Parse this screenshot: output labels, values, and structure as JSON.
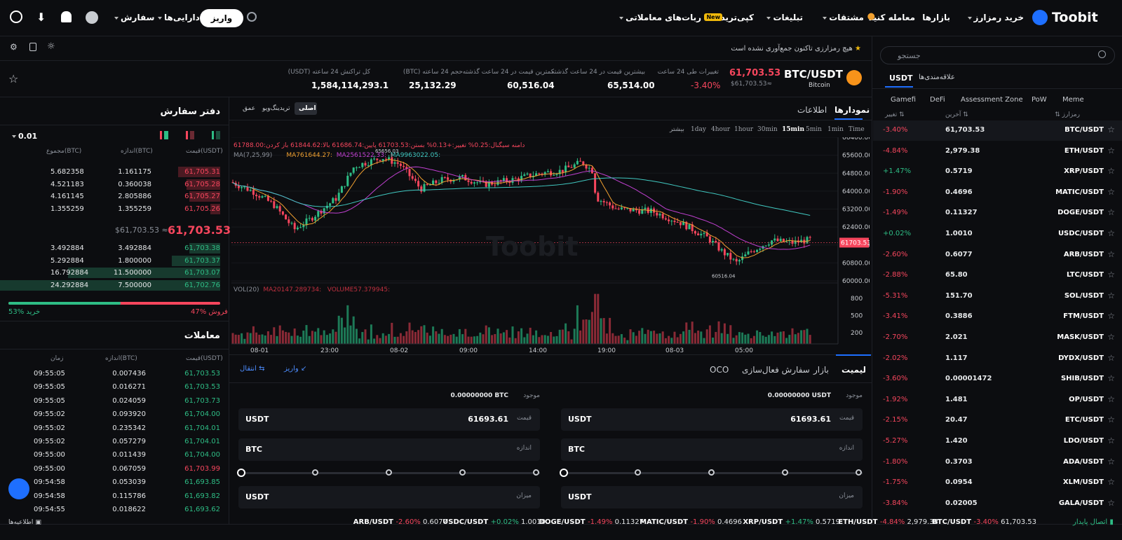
{
  "topbar": {
    "brand": "Toobit",
    "buy_crypto": "خرید رمزارز",
    "markets": "بازارها",
    "trade": "معامله کنید",
    "derivatives": "مشتقات",
    "promotions": "تبلیغات",
    "copy_trade": "کپی‌ترید",
    "bots": "ربات‌های معاملاتی",
    "new_badge": "New",
    "deposit": "واریز",
    "assets": "دارایی‌ها",
    "orders": "سفارش"
  },
  "favorites_hint": "هیچ رمزارزی تاکنون جمع‌آوری نشده است",
  "ticker": {
    "pair": "BTC/USDT",
    "name": "Bitcoin",
    "last": "61,703.53",
    "last_usd": "$61,703.53≈",
    "change_label": "تغییرات طی 24 ساعت",
    "change": "-3.40%",
    "high_label": "بیشترین قیمت در 24 ساعت گذشته",
    "high": "65,514.00",
    "low_label": "کمترین قیمت در 24 ساعت گذشته",
    "low": "60,516.04",
    "vol_label": "حجم 24 ساعته (BTC)",
    "vol": "25,132.29",
    "turnover_label": "کل تراکنش 24 ساعته (USDT)",
    "turnover": "1,584,114,293.1"
  },
  "chart_tabs": {
    "charts": "نمودارها",
    "info": "اطلاعات",
    "original": "اصلی",
    "tradingview": "تریدینگ‌ویو",
    "depth": "عمق"
  },
  "intervals": [
    "Time",
    "1min",
    "5min",
    "15min",
    "30min",
    "1hour",
    "4hour",
    "1day",
    "بیشتر"
  ],
  "active_interval": "15min",
  "ohlc_line": "دامنه سیگنال:0.25%  تغییر:+0.13%  بستن:61703.53  پایین:61686.74  بالا:61844.62  باز کردن:61788.00",
  "ma_line": {
    "label": "MA(7,25,99)",
    "ma7": "MA761644.27:",
    "ma25": "MA2561522.33:",
    "ma99": "MA9963022.05:"
  },
  "vol_line": {
    "label": "VOL(20)",
    "ma": "MA20147.289734:",
    "vol": "VOLUME57.379945:"
  },
  "price_ticks": [
    "66400.00",
    "65600.00",
    "64800.00",
    "64000.00",
    "63200.00",
    "62400.00",
    "61600.00",
    "60800.00",
    "60000.00"
  ],
  "vol_ticks": [
    "800",
    "500",
    "200"
  ],
  "time_ticks": [
    "08-01",
    "23:00",
    "08-02",
    "09:00",
    "14:00",
    "19:00",
    "08-03",
    "05:00"
  ],
  "high_marker": "65656.03",
  "low_marker": "60516.04",
  "last_tag": "61703.53",
  "watermark": "Toobit",
  "chart_data": {
    "type": "candlestick",
    "title": "",
    "ylim": [
      60000,
      66400
    ],
    "x_ticks": [
      "08-01",
      "23:00",
      "08-02",
      "09:00",
      "14:00",
      "19:00",
      "08-03",
      "05:00"
    ],
    "high": 65656.03,
    "low": 60516.04,
    "last": 61703.53,
    "series": [
      {
        "name": "MA7",
        "value": 61644.27
      },
      {
        "name": "MA25",
        "value": 61522.33
      },
      {
        "name": "MA99",
        "value": 63022.05
      }
    ],
    "volume": {
      "name": "VOLUME",
      "last": 57.379945,
      "ma20": 147.289734
    }
  },
  "orderbook": {
    "title": "دفتر سفارش",
    "step": "0.01",
    "h_price": "قیمت(USDT)",
    "h_size": "اندازه(BTC)",
    "h_total": "مجموع(BTC)",
    "asks": [
      {
        "price": "61,705.31",
        "size": "1.161175",
        "total": "5.682358",
        "depth": 1.0
      },
      {
        "price": "61,705.28",
        "size": "0.360038",
        "total": "4.521183",
        "depth": 0.8
      },
      {
        "price": "61,705.27",
        "size": "2.805886",
        "total": "4.161145",
        "depth": 0.73
      },
      {
        "price": "61,705.26",
        "size": "1.355259",
        "total": "1.355259",
        "depth": 0.24
      }
    ],
    "mid": "61,703.53",
    "mid_usd": "$61,703.53 ≈",
    "bids": [
      {
        "price": "61,703.38",
        "size": "3.492884",
        "total": "3.492884",
        "depth": 0.14
      },
      {
        "price": "61,703.37",
        "size": "1.800000",
        "total": "5.292884",
        "depth": 0.22
      },
      {
        "price": "61,703.07",
        "size": "11.500000",
        "total": "16.792884",
        "depth": 0.69
      },
      {
        "price": "61,702.76",
        "size": "7.500000",
        "total": "24.292884",
        "depth": 1.0
      }
    ],
    "buy_pct": "53%",
    "buy_label": "خرید",
    "sell_pct": "47%",
    "sell_label": "فروش",
    "buy_ratio": 0.53
  },
  "trades": {
    "title": "معاملات",
    "h_price": "قیمت(USDT)",
    "h_size": "اندازه(BTC)",
    "h_time": "زمان",
    "rows": [
      {
        "p": "61,703.53",
        "s": "0.007436",
        "t": "09:55:05",
        "side": "b"
      },
      {
        "p": "61,703.53",
        "s": "0.016271",
        "t": "09:55:05",
        "side": "b"
      },
      {
        "p": "61,703.73",
        "s": "0.024059",
        "t": "09:55:05",
        "side": "b"
      },
      {
        "p": "61,704.00",
        "s": "0.093920",
        "t": "09:55:02",
        "side": "b"
      },
      {
        "p": "61,704.01",
        "s": "0.235342",
        "t": "09:55:02",
        "side": "b"
      },
      {
        "p": "61,704.01",
        "s": "0.057279",
        "t": "09:55:02",
        "side": "b"
      },
      {
        "p": "61,704.00",
        "s": "0.011439",
        "t": "09:55:00",
        "side": "b"
      },
      {
        "p": "61,703.99",
        "s": "0.067059",
        "t": "09:55:00",
        "side": "s"
      },
      {
        "p": "61,693.85",
        "s": "0.053039",
        "t": "09:54:58",
        "side": "b"
      },
      {
        "p": "61,693.82",
        "s": "0.115786",
        "t": "09:54:58",
        "side": "b"
      },
      {
        "p": "61,693.62",
        "s": "0.018622",
        "t": "09:54:55",
        "side": "b"
      }
    ]
  },
  "order_form": {
    "limit": "لیمیت",
    "market": "بازار",
    "trigger": "سفارش فعال‌سازی",
    "oco": "OCO",
    "deposit": "واریز",
    "transfer": "انتقال",
    "available_label": "موجود",
    "buy_avail": "0.00000000 USDT",
    "sell_avail": "0.00000000 BTC",
    "price_label": "قیمت",
    "price": "61693.61",
    "size_label": "اندازه",
    "amount_label": "میزان",
    "usdt": "USDT",
    "btc": "BTC"
  },
  "market_list": {
    "search_placeholder": "جستجو",
    "tab_usdt": "USDT",
    "tab_fav": "علاقه‌مندی‌ها",
    "cats": [
      "Gamefi",
      "DeFi",
      "Assessment Zone",
      "PoW",
      "Meme"
    ],
    "h_symbol": "رمزارز",
    "h_last": "آخرین",
    "h_change": "تغییر",
    "rows": [
      {
        "sym": "BTC/USDT",
        "last": "61,703.53",
        "chg": "-3.40%",
        "up": false
      },
      {
        "sym": "ETH/USDT",
        "last": "2,979.38",
        "chg": "-4.84%",
        "up": false
      },
      {
        "sym": "XRP/USDT",
        "last": "0.5719",
        "chg": "+1.47%",
        "up": true
      },
      {
        "sym": "MATIC/USDT",
        "last": "0.4696",
        "chg": "-1.90%",
        "up": false
      },
      {
        "sym": "DOGE/USDT",
        "last": "0.11327",
        "chg": "-1.49%",
        "up": false
      },
      {
        "sym": "USDC/USDT",
        "last": "1.0010",
        "chg": "+0.02%",
        "up": true
      },
      {
        "sym": "ARB/USDT",
        "last": "0.6077",
        "chg": "-2.60%",
        "up": false
      },
      {
        "sym": "LTC/USDT",
        "last": "65.80",
        "chg": "-2.88%",
        "up": false
      },
      {
        "sym": "SOL/USDT",
        "last": "151.70",
        "chg": "-5.31%",
        "up": false
      },
      {
        "sym": "FTM/USDT",
        "last": "0.3886",
        "chg": "-3.41%",
        "up": false
      },
      {
        "sym": "MASK/USDT",
        "last": "2.021",
        "chg": "-2.70%",
        "up": false
      },
      {
        "sym": "DYDX/USDT",
        "last": "1.117",
        "chg": "-2.02%",
        "up": false
      },
      {
        "sym": "SHIB/USDT",
        "last": "0.00001472",
        "chg": "-3.60%",
        "up": false
      },
      {
        "sym": "OP/USDT",
        "last": "1.481",
        "chg": "-1.92%",
        "up": false
      },
      {
        "sym": "ETC/USDT",
        "last": "20.47",
        "chg": "-2.15%",
        "up": false
      },
      {
        "sym": "LDO/USDT",
        "last": "1.420",
        "chg": "-5.27%",
        "up": false
      },
      {
        "sym": "ADA/USDT",
        "last": "0.3703",
        "chg": "-1.80%",
        "up": false
      },
      {
        "sym": "XLM/USDT",
        "last": "0.0954",
        "chg": "-1.75%",
        "up": false
      },
      {
        "sym": "GALA/USDT",
        "last": "0.02005",
        "chg": "-3.84%",
        "up": false
      }
    ]
  },
  "bottom": {
    "connection": "اتصال پایدار",
    "notices": "اطلاعیه‌ها",
    "tickers": [
      {
        "sym": "BTC/USDT",
        "chg": "-3.40%",
        "price": "61,703.53",
        "up": false
      },
      {
        "sym": "ETH/USDT",
        "chg": "-4.84%",
        "price": "2,979.38",
        "up": false
      },
      {
        "sym": "XRP/USDT",
        "chg": "+1.47%",
        "price": "0.5719",
        "up": true
      },
      {
        "sym": "MATIC/USDT",
        "chg": "-1.90%",
        "price": "0.4696",
        "up": false
      },
      {
        "sym": "DOGE/USDT",
        "chg": "-1.49%",
        "price": "0.11327",
        "up": false
      },
      {
        "sym": "USDC/USDT",
        "chg": "+0.02%",
        "price": "1.0010",
        "up": true
      },
      {
        "sym": "ARB/USDT",
        "chg": "-2.60%",
        "price": "0.6077",
        "up": false
      }
    ]
  },
  "colors": {
    "up": "#2ebd85",
    "down": "#f6465d",
    "accent": "#1e6fff",
    "ma7": "#f0a030",
    "ma25": "#c040d0",
    "ma99": "#40c8c0"
  }
}
